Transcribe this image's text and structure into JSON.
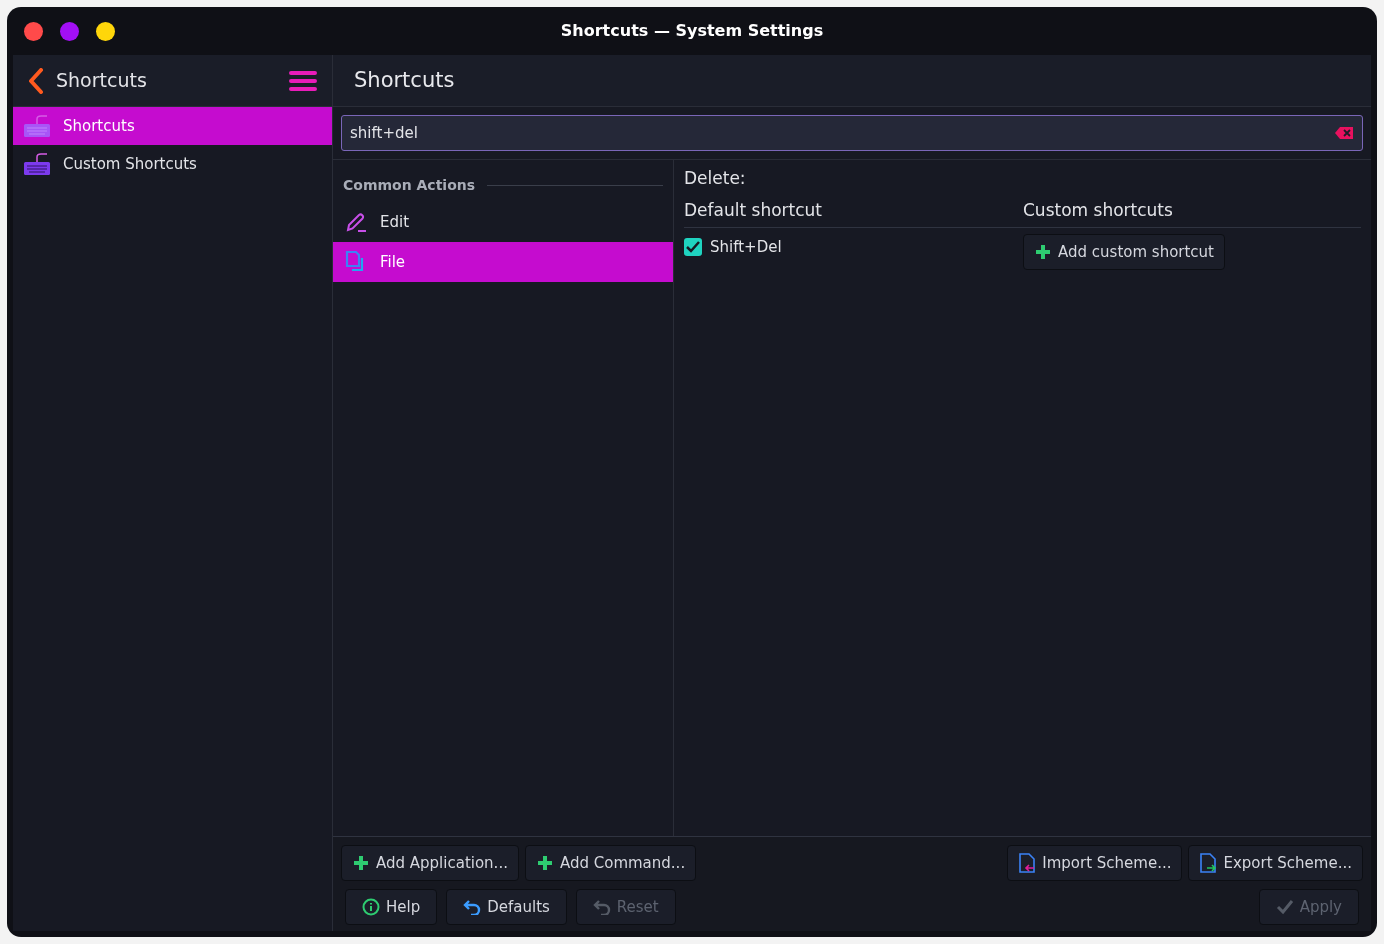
{
  "window": {
    "title": "Shortcuts — System Settings"
  },
  "sidebar": {
    "title": "Shortcuts",
    "items": [
      {
        "label": "Shortcuts",
        "selected": true
      },
      {
        "label": "Custom Shortcuts",
        "selected": false
      }
    ]
  },
  "page": {
    "title": "Shortcuts"
  },
  "search": {
    "value": "shift+del"
  },
  "actions": {
    "heading": "Common Actions",
    "items": [
      {
        "label": "Edit",
        "kind": "edit",
        "selected": false
      },
      {
        "label": "File",
        "kind": "file",
        "selected": true
      }
    ]
  },
  "detail": {
    "title": "Delete:",
    "default_heading": "Default shortcut",
    "custom_heading": "Custom shortcuts",
    "default_shortcut": {
      "label": "Shift+Del",
      "checked": true
    },
    "add_button": "Add custom shortcut"
  },
  "toolbar": {
    "left": [
      {
        "label": "Add Application...",
        "kind": "add"
      },
      {
        "label": "Add Command...",
        "kind": "add"
      }
    ],
    "right": [
      {
        "label": "Import Scheme...",
        "kind": "import"
      },
      {
        "label": "Export Scheme...",
        "kind": "export"
      }
    ]
  },
  "footer": {
    "left": [
      {
        "label": "Help",
        "kind": "help",
        "disabled": false
      },
      {
        "label": "Defaults",
        "kind": "undo",
        "disabled": false
      },
      {
        "label": "Reset",
        "kind": "undo",
        "disabled": true
      }
    ],
    "right": [
      {
        "label": "Apply",
        "kind": "apply",
        "disabled": true
      }
    ]
  }
}
